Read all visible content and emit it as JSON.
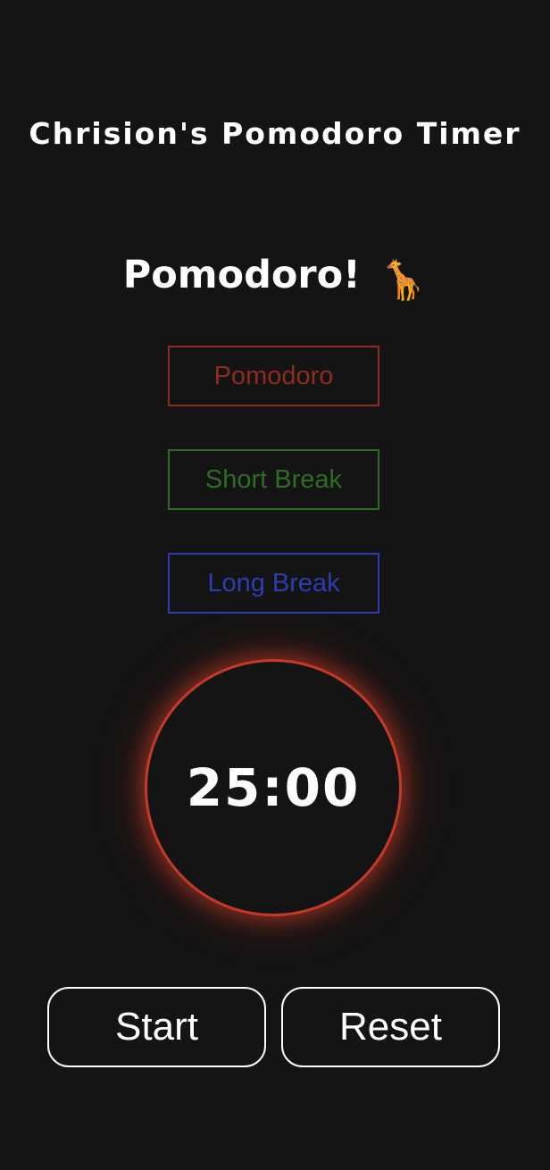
{
  "app": {
    "title": "Chrision's Pomodoro Timer"
  },
  "mode": {
    "heading": "Pomodoro!",
    "emoji": "🦒"
  },
  "mode_buttons": {
    "pomodoro": "Pomodoro",
    "short_break": "Short Break",
    "long_break": "Long Break"
  },
  "timer": {
    "display": "25:00"
  },
  "controls": {
    "start": "Start",
    "reset": "Reset"
  },
  "colors": {
    "background": "#141414",
    "pomodoro": "#8e2c21",
    "short_break": "#2f6b26",
    "long_break": "#2f3cb0",
    "ring_glow": "#c23a29"
  }
}
